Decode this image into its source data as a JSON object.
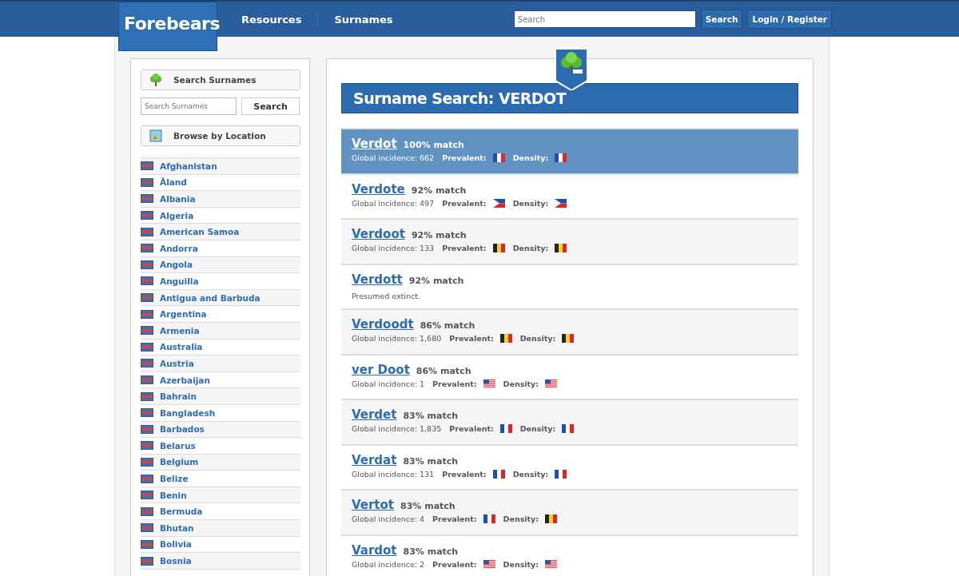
{
  "header": {
    "logo": "Forebears",
    "nav": [
      {
        "label": "Resources"
      },
      {
        "label": "Surnames"
      }
    ],
    "search": {
      "placeholder": "Search",
      "button": "Search"
    },
    "login": "Login / Register"
  },
  "sidebar": {
    "search_surnames": "Search Surnames",
    "search_field": {
      "placeholder": "Search Surnames"
    },
    "search_button": "Search",
    "browse": "Browse by Location",
    "countries": [
      {
        "name": "Afghanistan"
      },
      {
        "name": "Åland"
      },
      {
        "name": "Albania"
      },
      {
        "name": "Algeria"
      },
      {
        "name": "American Samoa"
      },
      {
        "name": "Andorra"
      },
      {
        "name": "Angola"
      },
      {
        "name": "Anguilla"
      },
      {
        "name": "Antigua and Barbuda"
      },
      {
        "name": "Argentina"
      },
      {
        "name": "Armenia"
      },
      {
        "name": "Australia"
      },
      {
        "name": "Austria"
      },
      {
        "name": "Azerbaijan"
      },
      {
        "name": "Bahrain"
      },
      {
        "name": "Bangladesh"
      },
      {
        "name": "Barbados"
      },
      {
        "name": "Belarus"
      },
      {
        "name": "Belgium"
      },
      {
        "name": "Belize"
      },
      {
        "name": "Benin"
      },
      {
        "name": "Bermuda"
      },
      {
        "name": "Bhutan"
      },
      {
        "name": "Bolivia"
      },
      {
        "name": "Bosnia"
      }
    ]
  },
  "main": {
    "title": "Surname Search: VERDOT",
    "results": [
      {
        "name": "Verdot",
        "match": "100% match",
        "selected": true,
        "kind": "stats",
        "incidence": "Global incidence: 662",
        "prevalent_label": "Prevalent:",
        "prevalent_flag": {
          "kind": "fr"
        },
        "density_label": "Density:",
        "density_flag": {
          "kind": "fr"
        }
      },
      {
        "name": "Verdote",
        "match": "92% match",
        "selected": false,
        "kind": "stats",
        "incidence": "Global incidence: 497",
        "prevalent_label": "Prevalent:",
        "prevalent_flag": {
          "kind": "ph"
        },
        "density_label": "Density:",
        "density_flag": {
          "kind": "ph"
        }
      },
      {
        "name": "Verdoot",
        "match": "92% match",
        "selected": false,
        "kind": "stats",
        "incidence": "Global incidence: 133",
        "prevalent_label": "Prevalent:",
        "prevalent_flag": {
          "kind": "be"
        },
        "density_label": "Density:",
        "density_flag": {
          "kind": "be"
        }
      },
      {
        "name": "Verdott",
        "match": "92% match",
        "selected": false,
        "kind": "extinct",
        "note": "Presumed extinct."
      },
      {
        "name": "Verdoodt",
        "match": "86% match",
        "selected": false,
        "kind": "stats",
        "incidence": "Global incidence: 1,680",
        "prevalent_label": "Prevalent:",
        "prevalent_flag": {
          "kind": "be"
        },
        "density_label": "Density:",
        "density_flag": {
          "kind": "be"
        }
      },
      {
        "name": "ver Doot",
        "match": "86% match",
        "selected": false,
        "kind": "stats",
        "incidence": "Global incidence: 1",
        "prevalent_label": "Prevalent:",
        "prevalent_flag": {
          "kind": "us"
        },
        "density_label": "Density:",
        "density_flag": {
          "kind": "us"
        }
      },
      {
        "name": "Verdet",
        "match": "83% match",
        "selected": false,
        "kind": "stats",
        "incidence": "Global incidence: 1,835",
        "prevalent_label": "Prevalent:",
        "prevalent_flag": {
          "kind": "fr"
        },
        "density_label": "Density:",
        "density_flag": {
          "kind": "fr"
        }
      },
      {
        "name": "Verdat",
        "match": "83% match",
        "selected": false,
        "kind": "stats",
        "incidence": "Global incidence: 131",
        "prevalent_label": "Prevalent:",
        "prevalent_flag": {
          "kind": "fr"
        },
        "density_label": "Density:",
        "density_flag": {
          "kind": "fr"
        }
      },
      {
        "name": "Vertot",
        "match": "83% match",
        "selected": false,
        "kind": "stats",
        "incidence": "Global incidence: 4",
        "prevalent_label": "Prevalent:",
        "prevalent_flag": {
          "kind": "fr"
        },
        "density_label": "Density:",
        "density_flag": {
          "kind": "be"
        }
      },
      {
        "name": "Vardot",
        "match": "83% match",
        "selected": false,
        "kind": "stats",
        "incidence": "Global incidence: 2",
        "prevalent_label": "Prevalent:",
        "prevalent_flag": {
          "kind": "us"
        },
        "density_label": "Density:",
        "density_flag": {
          "kind": "us"
        }
      }
    ]
  }
}
